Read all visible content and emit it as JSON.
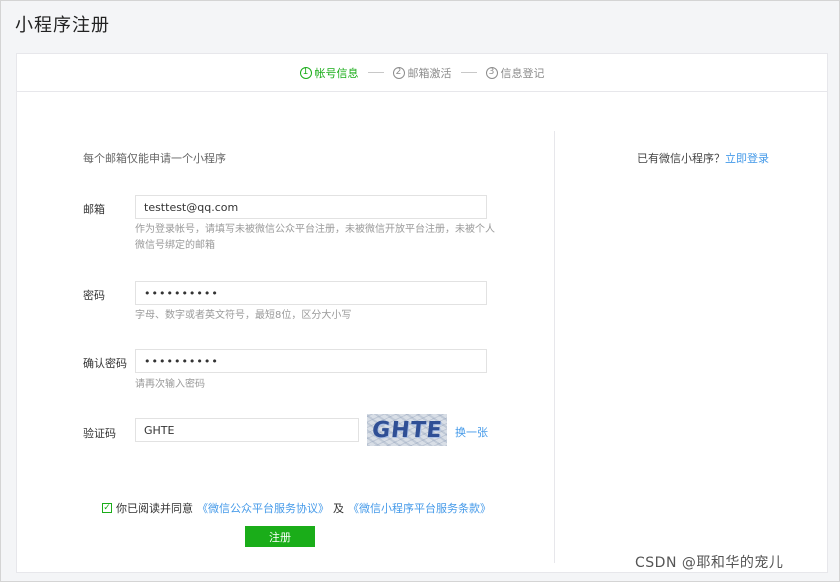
{
  "page": {
    "title": "小程序注册"
  },
  "steps": [
    {
      "num": "1",
      "label": "帐号信息",
      "active": true
    },
    {
      "num": "2",
      "label": "邮箱激活",
      "active": false
    },
    {
      "num": "3",
      "label": "信息登记",
      "active": false
    }
  ],
  "form": {
    "intro": "每个邮箱仅能申请一个小程序",
    "email": {
      "label": "邮箱",
      "value": "testtest@qq.com",
      "hint": "作为登录帐号，请填写未被微信公众平台注册，未被微信开放平台注册，未被个人微信号绑定的邮箱"
    },
    "password": {
      "label": "密码",
      "value": "••••••••••",
      "hint": "字母、数字或者英文符号，最短8位，区分大小写"
    },
    "confirm": {
      "label": "确认密码",
      "value": "••••••••••",
      "hint": "请再次输入密码"
    },
    "captcha": {
      "label": "验证码",
      "value": "GHTE",
      "image_text": "GHTE",
      "refresh": "换一张"
    },
    "agree": {
      "prefix": "你已阅读并同意",
      "link1": "《微信公众平台服务协议》",
      "mid": "及",
      "link2": "《微信小程序平台服务条款》"
    },
    "submit": "注册"
  },
  "aside": {
    "text": "已有微信小程序？",
    "link": "立即登录"
  },
  "watermark": "CSDN @耶和华的宠儿",
  "colors": {
    "accent": "#1aad19",
    "link": "#459ae9"
  }
}
